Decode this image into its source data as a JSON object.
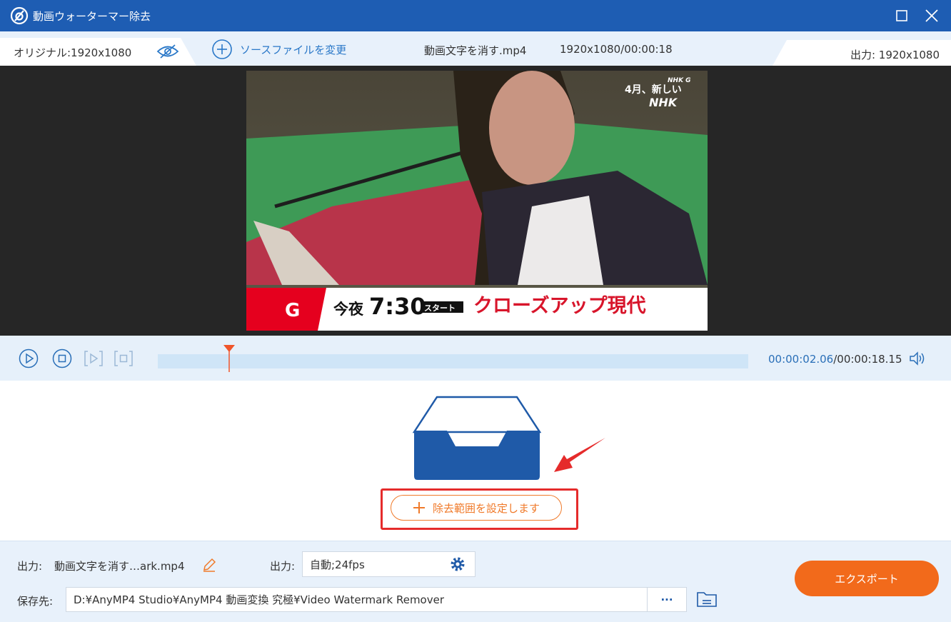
{
  "app": {
    "title": "動画ウォーターマー除去"
  },
  "infobar": {
    "original_label": "オリジナル:1920x1080",
    "change_source_label": "ソースファイルを変更",
    "file_name": "動画文字を消す.mp4",
    "file_meta": "1920x1080/00:00:18",
    "output_label": "出力: 1920x1080"
  },
  "video": {
    "corner_logo_small": "NHK G",
    "corner_text": "4月、新しい",
    "corner_logo": "NHK",
    "banner_channel": "G",
    "banner_prefix": "今夜",
    "banner_time": "7:30",
    "banner_tag": "スタート",
    "banner_title": "クローズアップ現代"
  },
  "player": {
    "current_time": "00:00:02.06",
    "total_time": "/00:00:18.15",
    "progress": 0.12
  },
  "middle": {
    "set_range_label": "除去範囲を設定します"
  },
  "bottom": {
    "output_name_label": "出力:",
    "output_name_value": "動画文字を消す…ark.mp4",
    "output_format_label": "出力:",
    "output_format_value": "自動;24fps",
    "save_label": "保存先:",
    "save_path": "D:¥AnyMP4 Studio¥AnyMP4 動画変換 究極¥Video Watermark Remover",
    "browse_label": "···",
    "export_label": "エクスポート"
  },
  "colors": {
    "titlebar": "#1e5db3",
    "accent_orange": "#f26a1b",
    "highlight_red": "#e52b2b",
    "link_blue": "#2a78c8"
  }
}
